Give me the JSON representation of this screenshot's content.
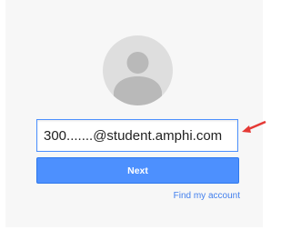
{
  "login": {
    "email_value": "300.......@student.amphi.com",
    "next_label": "Next",
    "find_account_label": "Find my account"
  },
  "colors": {
    "accent": "#4d90fe",
    "link": "#427fed",
    "annotation_arrow": "#e53935"
  },
  "icons": [
    "avatar-icon",
    "red-arrow-icon"
  ]
}
